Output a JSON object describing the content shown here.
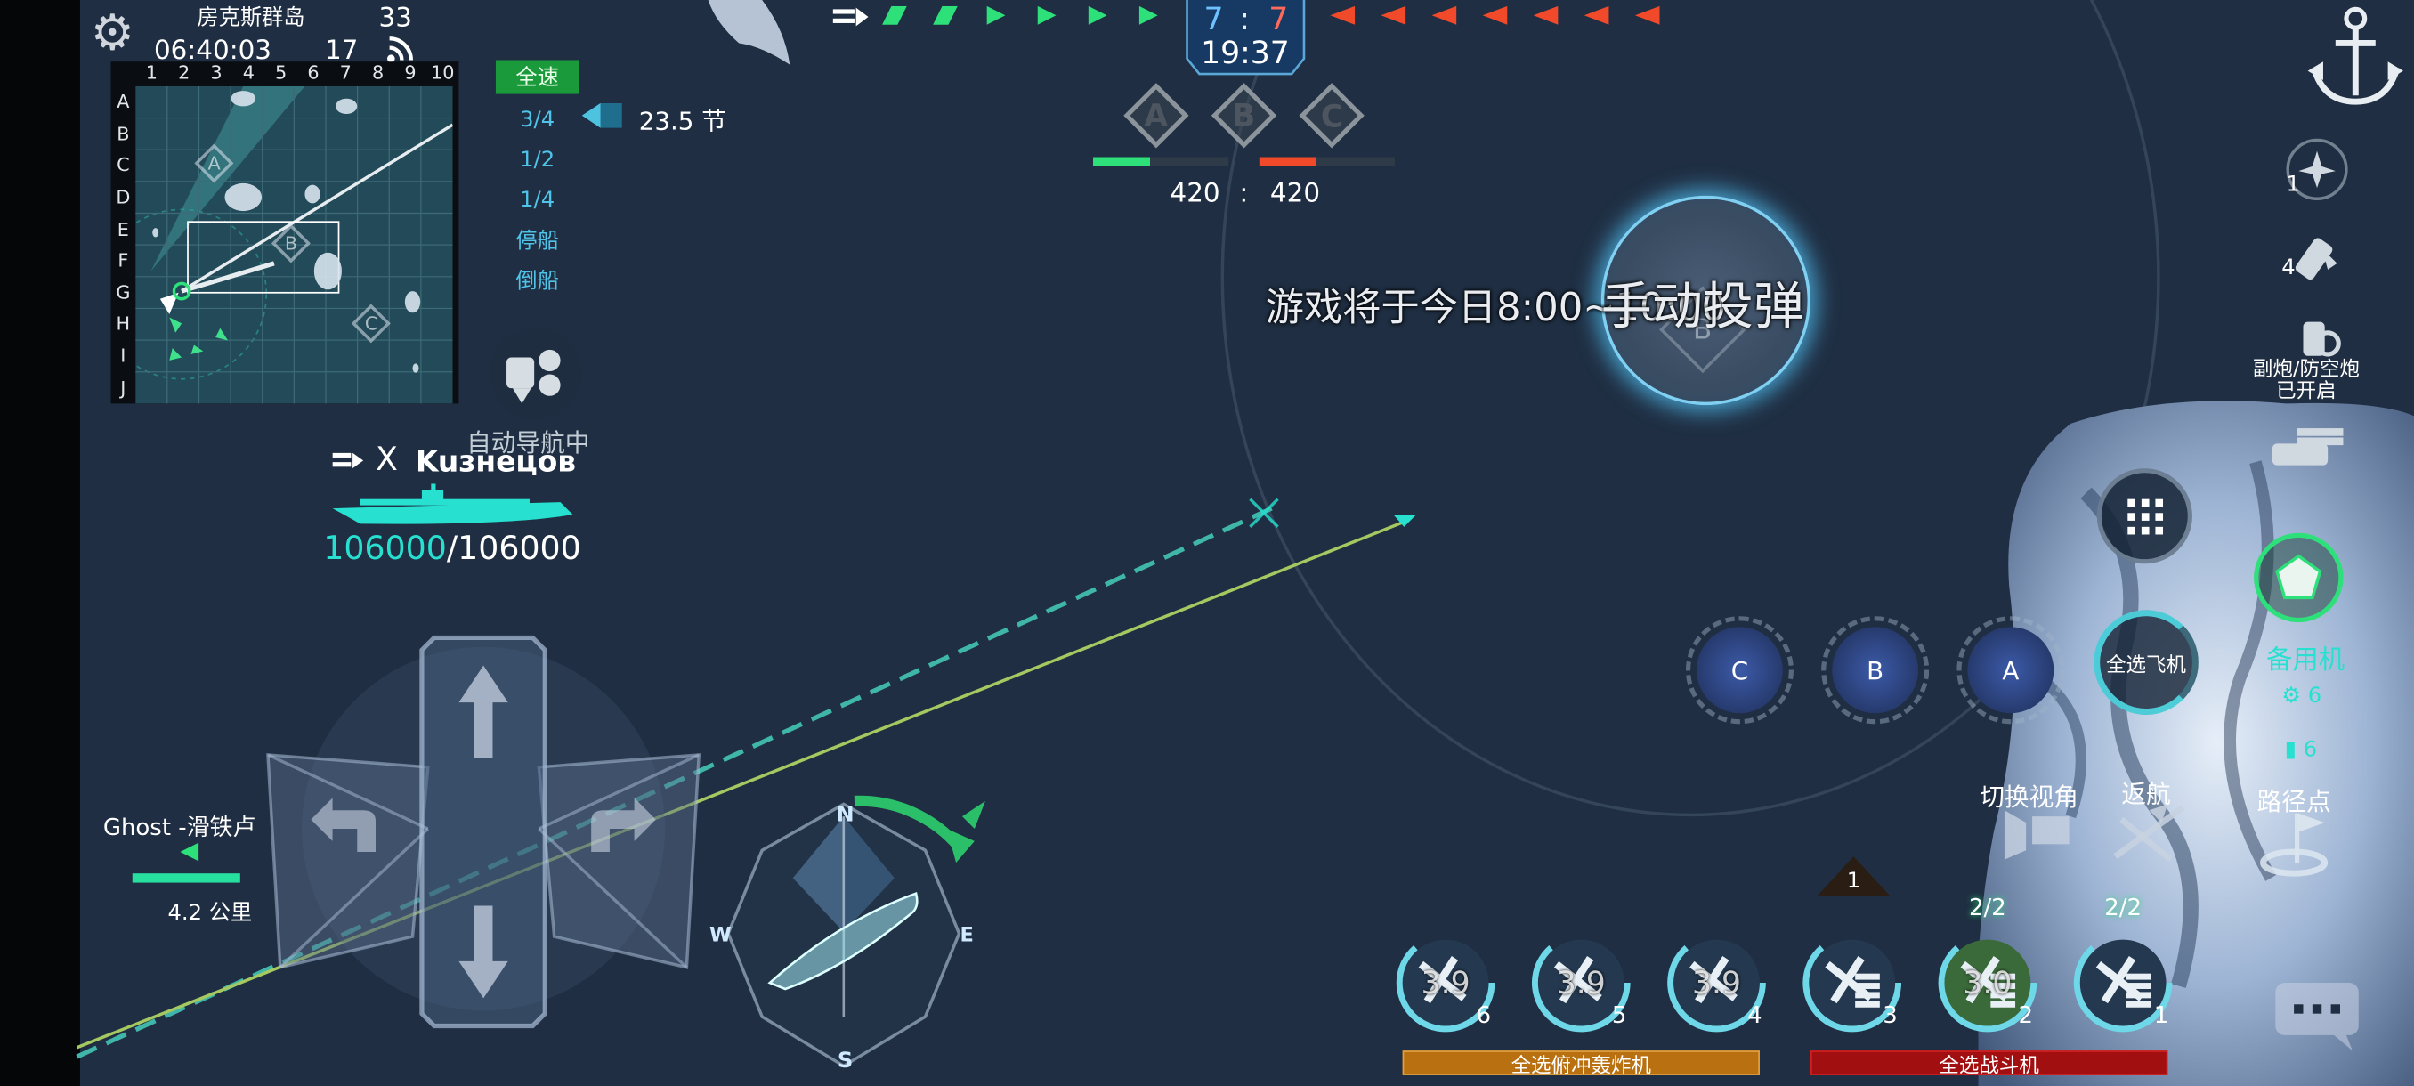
{
  "header": {
    "map_name": "房克斯群岛",
    "time": "06:40:03",
    "ping": "33",
    "fps": "17"
  },
  "minimap": {
    "cols": [
      "1",
      "2",
      "3",
      "4",
      "5",
      "6",
      "7",
      "8",
      "9",
      "10"
    ],
    "rows": [
      "A",
      "B",
      "C",
      "D",
      "E",
      "F",
      "G",
      "H",
      "I",
      "J"
    ],
    "points": [
      "A",
      "B",
      "C"
    ]
  },
  "speed": {
    "options": [
      "全速",
      "3/4",
      "1/2",
      "1/4",
      "停船",
      "倒船"
    ],
    "selected": "全速",
    "current": "23.5 节"
  },
  "autopilot": {
    "label": "自动导航中"
  },
  "score": {
    "ally_points": "7",
    "separator": ":",
    "enemy_points": "7",
    "timer": "19:37",
    "capture_points": [
      "A",
      "B",
      "C"
    ],
    "ally_score": "420",
    "score_separator": ":",
    "enemy_score": "420",
    "ally_progress": 0.42,
    "enemy_progress": 0.42
  },
  "ship": {
    "prefix": "X",
    "name": "Kuзнецов",
    "hp_current": "106000",
    "hp_max": "/106000",
    "hp_fraction": 1.0
  },
  "target": {
    "name": "Ghost -滑铁卢",
    "distance": "4.2  公里"
  },
  "notice": {
    "message": "游戏将于今日8:00~10:00",
    "bomb_button": "手动投弹",
    "bomb_point": "B"
  },
  "compass": {
    "n": "N",
    "s": "S",
    "e": "E",
    "w": "W"
  },
  "right_panel": {
    "slot1_count": "1",
    "slot2_count": "4",
    "secondary_status": "副炮/防空炮\n已开启",
    "select_all_planes": "全选飞机",
    "spare_planes": "备用机",
    "spare_count_a": "6",
    "spare_count_b": "6",
    "switch_view": "切换视角",
    "return": "返航",
    "waypoint": "路径点",
    "squad_points": [
      "C",
      "B",
      "A"
    ]
  },
  "squadrons": [
    {
      "label": "3.9",
      "num": "6",
      "type": "bomber"
    },
    {
      "label": "3.9",
      "num": "5",
      "type": "bomber"
    },
    {
      "label": "3.9",
      "num": "4",
      "type": "bomber"
    },
    {
      "label": "",
      "num": "3",
      "type": "fighter"
    },
    {
      "label": "3.0",
      "num": "2",
      "type": "fighter",
      "top": "2/2"
    },
    {
      "label": "",
      "num": "1",
      "type": "fighter",
      "top": "2/2"
    }
  ],
  "squad_marker": "1",
  "bottom_buttons": {
    "dive_bombers": "全选俯冲轰炸机",
    "fighters": "全选战斗机"
  },
  "colors": {
    "ally": "#2de07a",
    "enemy": "#f04a2a",
    "cyan": "#27e0d0",
    "bg": "#1f2e42"
  }
}
